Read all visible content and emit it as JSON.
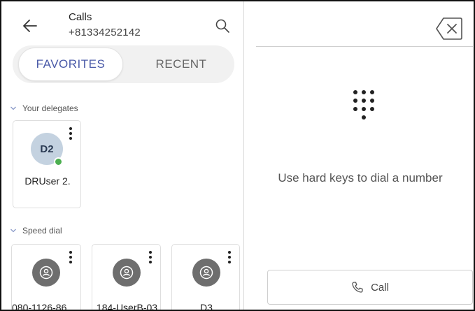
{
  "header": {
    "title": "Calls",
    "number": "+81334252142",
    "back_icon": "arrow-left-icon",
    "search_icon": "search-icon"
  },
  "tabs": [
    {
      "label": "FAVORITES",
      "selected": true
    },
    {
      "label": "RECENT",
      "selected": false
    }
  ],
  "sections": {
    "delegates": {
      "title": "Your delegates",
      "items": [
        {
          "initials": "D2",
          "name": "DRUser 2.",
          "status": "available"
        }
      ]
    },
    "speed_dial": {
      "title": "Speed dial",
      "items": [
        {
          "name": "080-1126-86..."
        },
        {
          "name": "184-UserB-03"
        },
        {
          "name": "D3"
        }
      ]
    }
  },
  "dialer": {
    "backspace_icon": "backspace-icon",
    "dialpad_icon": "dialpad-icon",
    "hint": "Use hard keys to dial a number",
    "call_label": "Call",
    "call_icon": "phone-icon"
  },
  "colors": {
    "accent": "#4a5aa8",
    "presence": "#4caf50",
    "avatar_bg": "#c4d2e0",
    "avatar_gray": "#6e6e6e"
  }
}
